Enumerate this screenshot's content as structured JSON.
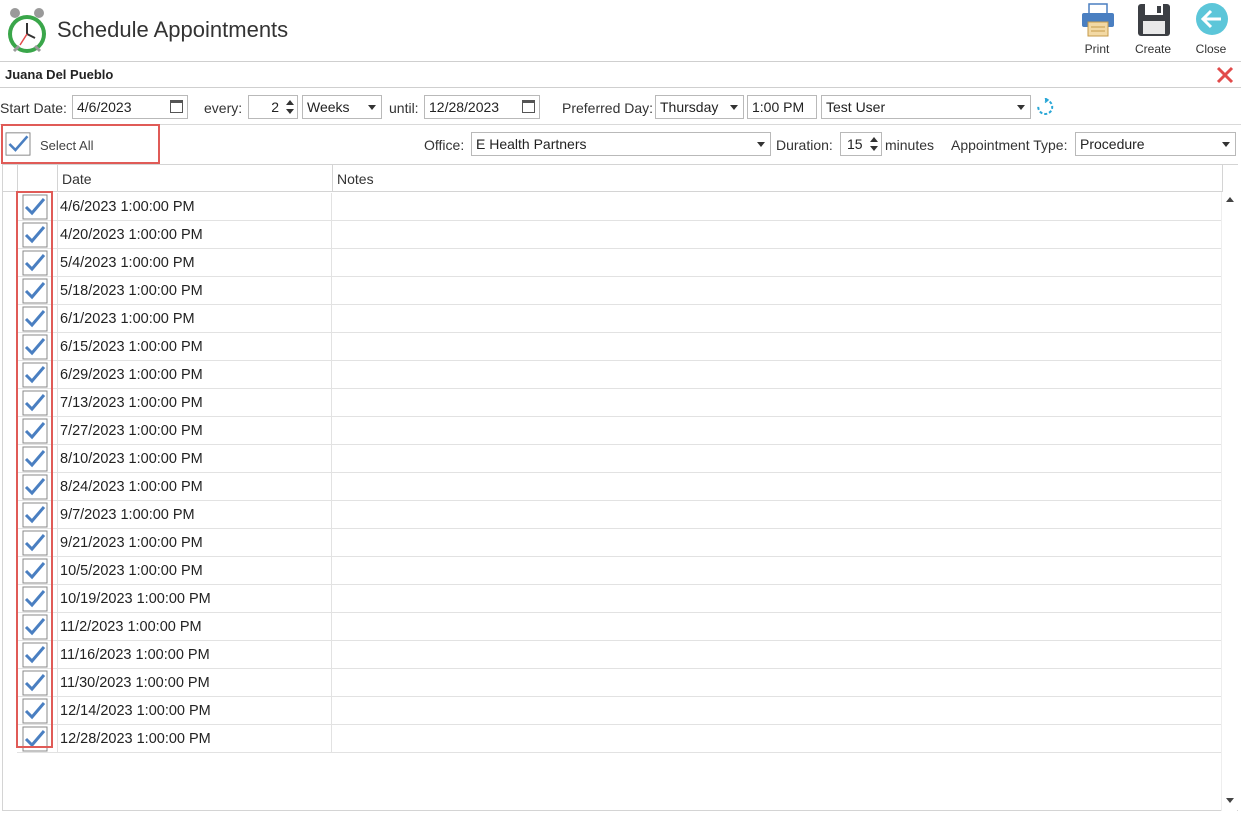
{
  "header": {
    "title": "Schedule Appointments",
    "print_label": "Print",
    "create_label": "Create",
    "close_label": "Close"
  },
  "patient": {
    "name": "Juana Del Pueblo"
  },
  "schedule": {
    "start_date_label": "Start Date:",
    "start_date": "4/6/2023",
    "every_label": "every:",
    "every_value": "2",
    "unit": "Weeks",
    "until_label": "until:",
    "until_date": "12/28/2023",
    "preferred_day_label": "Preferred Day:",
    "preferred_day": "Thursday",
    "time": "1:00 PM",
    "user": "Test User"
  },
  "options": {
    "select_all_label": "Select All",
    "office_label": "Office:",
    "office": "E Health Partners",
    "duration_label": "Duration:",
    "duration": "15",
    "minutes_label": "minutes",
    "appt_type_label": "Appointment Type:",
    "appt_type": "Procedure"
  },
  "grid": {
    "columns": [
      "Date",
      "Notes"
    ],
    "rows": [
      {
        "date": "4/6/2023 1:00:00 PM",
        "checked": true
      },
      {
        "date": "4/20/2023 1:00:00 PM",
        "checked": true
      },
      {
        "date": "5/4/2023 1:00:00 PM",
        "checked": true
      },
      {
        "date": "5/18/2023 1:00:00 PM",
        "checked": true
      },
      {
        "date": "6/1/2023 1:00:00 PM",
        "checked": true
      },
      {
        "date": "6/15/2023 1:00:00 PM",
        "checked": true
      },
      {
        "date": "6/29/2023 1:00:00 PM",
        "checked": true
      },
      {
        "date": "7/13/2023 1:00:00 PM",
        "checked": true
      },
      {
        "date": "7/27/2023 1:00:00 PM",
        "checked": true
      },
      {
        "date": "8/10/2023 1:00:00 PM",
        "checked": true
      },
      {
        "date": "8/24/2023 1:00:00 PM",
        "checked": true
      },
      {
        "date": "9/7/2023 1:00:00 PM",
        "checked": true
      },
      {
        "date": "9/21/2023 1:00:00 PM",
        "checked": true
      },
      {
        "date": "10/5/2023 1:00:00 PM",
        "checked": true
      },
      {
        "date": "10/19/2023 1:00:00 PM",
        "checked": true
      },
      {
        "date": "11/2/2023 1:00:00 PM",
        "checked": true
      },
      {
        "date": "11/16/2023 1:00:00 PM",
        "checked": true
      },
      {
        "date": "11/30/2023 1:00:00 PM",
        "checked": true
      },
      {
        "date": "12/14/2023 1:00:00 PM",
        "checked": true
      },
      {
        "date": "12/28/2023 1:00:00 PM",
        "checked": true
      }
    ]
  },
  "colors": {
    "highlight": "#e05b57",
    "check": "#4a7fc1",
    "close_red": "#e24b4b",
    "refresh": "#2aa7d6"
  },
  "icons": {
    "app": "alarm-clock-icon",
    "print": "printer-icon",
    "create": "floppy-disk-icon",
    "close": "back-arrow-icon",
    "clear": "close-icon",
    "refresh": "refresh-icon"
  }
}
